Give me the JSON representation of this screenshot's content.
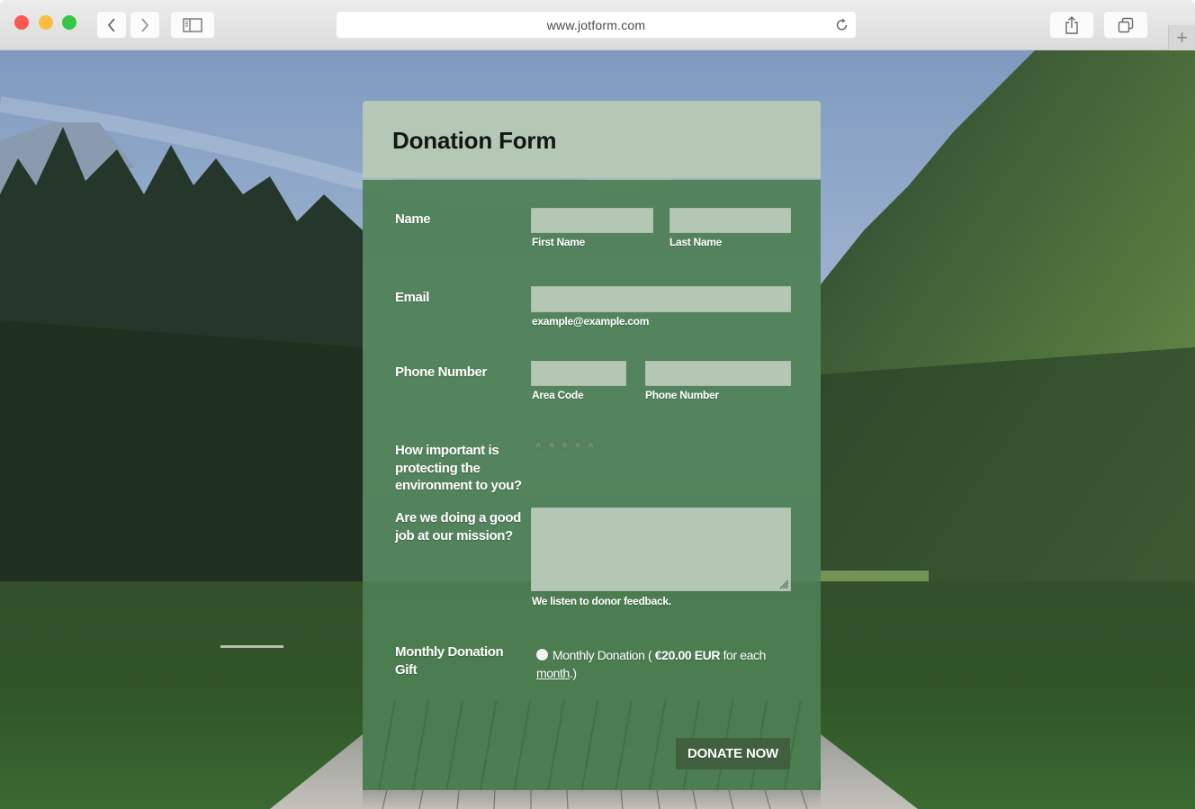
{
  "browser": {
    "url": "www.jotform.com",
    "buttons": {
      "back": "chevron-left",
      "forward": "chevron-right",
      "sidebar": "sidebar",
      "reload": "reload",
      "share": "share",
      "tabs": "tabs",
      "new_tab": "+"
    }
  },
  "form": {
    "title": "Donation Form",
    "fields": {
      "name": {
        "label": "Name",
        "first": {
          "value": "",
          "sublabel": "First Name"
        },
        "last": {
          "value": "",
          "sublabel": "Last Name"
        }
      },
      "email": {
        "label": "Email",
        "value": "",
        "sublabel": "example@example.com"
      },
      "phone": {
        "label": "Phone Number",
        "area": {
          "value": "",
          "sublabel": "Area Code"
        },
        "number": {
          "value": "",
          "sublabel": "Phone Number"
        }
      },
      "rating": {
        "label": "How important is protecting the environment to you?",
        "max_stars": 5,
        "value": 0,
        "star_glyph": "★"
      },
      "mission": {
        "label": "Are we doing a good job at our mission?",
        "value": "",
        "sublabel": "We listen to donor feedback."
      },
      "monthly": {
        "label": "Monthly Donation Gift",
        "option_prefix": "Monthly Donation ( ",
        "amount": "€20.00 EUR",
        "option_middle": " for each ",
        "period_link": "month",
        "option_suffix": ".)",
        "selected": false
      }
    },
    "submit_label": "DONATE NOW"
  },
  "colors": {
    "header_bg": "#b5c8b6",
    "body_bg": "#4d8054",
    "field_bg": "#b4c7b5",
    "button_bg": "#41603f"
  }
}
